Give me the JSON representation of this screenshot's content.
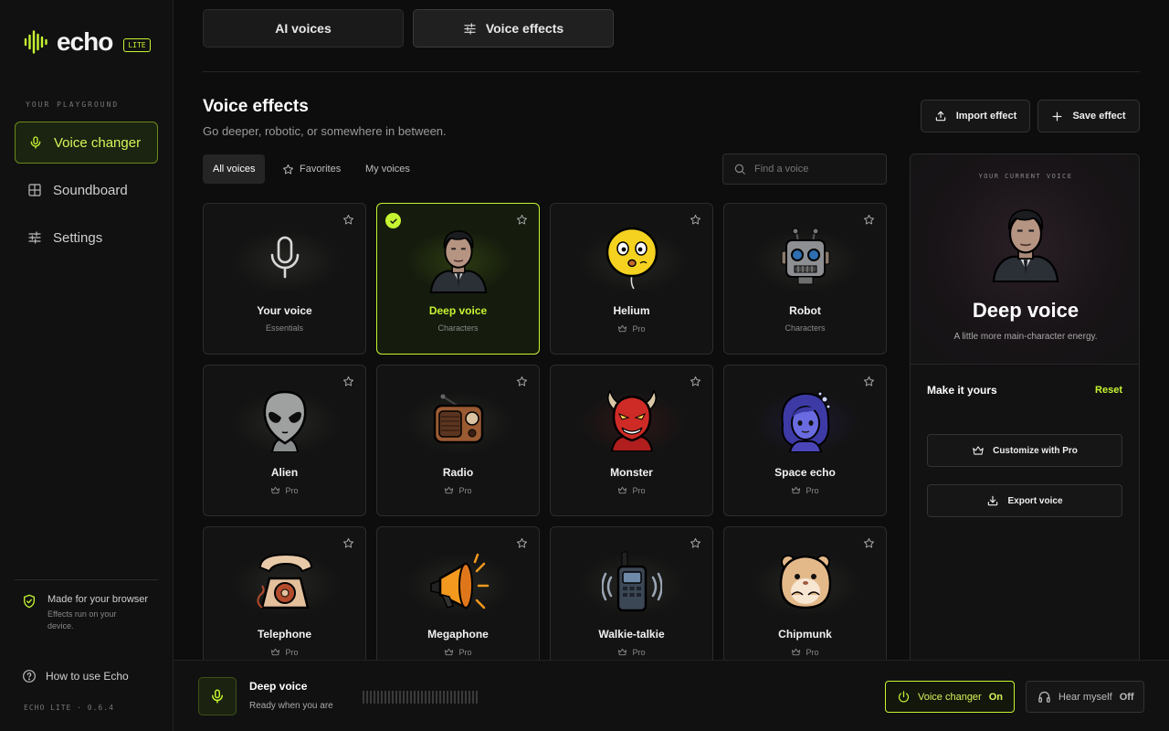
{
  "brand": {
    "name": "echo",
    "badge": "LITE",
    "accent": "#c6f432"
  },
  "sidebar": {
    "section_label": "YOUR PLAYGROUND",
    "items": [
      {
        "label": "Voice changer",
        "icon": "mic-icon",
        "active": true
      },
      {
        "label": "Soundboard",
        "icon": "grid-icon",
        "active": false
      },
      {
        "label": "Settings",
        "icon": "sliders-icon",
        "active": false
      }
    ],
    "footer_title": "Made for your browser",
    "footer_sub": "Effects run on your device.",
    "help": "How to use Echo",
    "version": "ECHO LITE · 0.6.4"
  },
  "tabs": [
    {
      "label": "AI voices",
      "active": false
    },
    {
      "label": "Voice effects",
      "active": true
    }
  ],
  "header": {
    "title": "Voice effects",
    "subtitle": "Go deeper, robotic, or somewhere in between.",
    "import_label": "Import effect",
    "save_label": "Save effect"
  },
  "filters": [
    {
      "label": "All voices",
      "active": true
    },
    {
      "label": "Favorites",
      "active": false
    },
    {
      "label": "My voices",
      "active": false
    }
  ],
  "search": {
    "placeholder": "Find a voice"
  },
  "voices": [
    {
      "name": "Your voice",
      "tag": "Essentials",
      "pro": false,
      "selected": false,
      "icon": "microphone-icon"
    },
    {
      "name": "Deep voice",
      "tag": "Characters",
      "pro": false,
      "selected": true,
      "icon": "man-portrait-icon"
    },
    {
      "name": "Helium",
      "tag": "Pro",
      "pro": true,
      "selected": false,
      "icon": "balloon-face-icon"
    },
    {
      "name": "Robot",
      "tag": "Characters",
      "pro": false,
      "selected": false,
      "icon": "robot-head-icon"
    },
    {
      "name": "Alien",
      "tag": "Pro",
      "pro": true,
      "selected": false,
      "icon": "alien-head-icon"
    },
    {
      "name": "Radio",
      "tag": "Pro",
      "pro": true,
      "selected": false,
      "icon": "radio-icon"
    },
    {
      "name": "Monster",
      "tag": "Pro",
      "pro": true,
      "selected": false,
      "icon": "devil-face-icon"
    },
    {
      "name": "Space echo",
      "tag": "Pro",
      "pro": true,
      "selected": false,
      "icon": "space-girl-icon"
    },
    {
      "name": "Telephone",
      "tag": "Pro",
      "pro": true,
      "selected": false,
      "icon": "telephone-icon"
    },
    {
      "name": "Megaphone",
      "tag": "Pro",
      "pro": true,
      "selected": false,
      "icon": "megaphone-icon"
    },
    {
      "name": "Walkie-talkie",
      "tag": "Pro",
      "pro": true,
      "selected": false,
      "icon": "walkie-talkie-icon"
    },
    {
      "name": "Chipmunk",
      "tag": "Pro",
      "pro": true,
      "selected": false,
      "icon": "hamster-icon"
    }
  ],
  "panel": {
    "label": "YOUR CURRENT VOICE",
    "name": "Deep voice",
    "description": "A little more main-character energy.",
    "make_title": "Make it yours",
    "reset": "Reset",
    "customize_label": "Customize with Pro",
    "export_label": "Export voice"
  },
  "bottom_bar": {
    "voice_name": "Deep voice",
    "status": "Ready when you are",
    "changer_label": "Voice changer",
    "changer_state": "On",
    "hear_label": "Hear myself",
    "hear_state": "Off"
  }
}
